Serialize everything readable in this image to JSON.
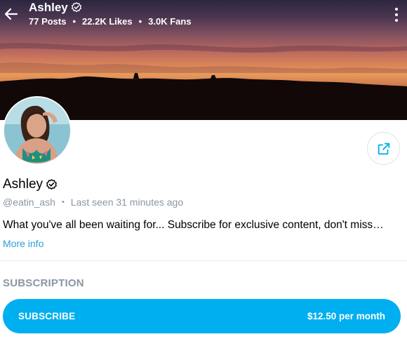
{
  "header": {
    "name": "Ashley",
    "posts": "77 Posts",
    "likes": "22.2K Likes",
    "fans": "3.0K Fans",
    "separator": "•"
  },
  "icons": {
    "back": "arrow-left-icon",
    "more": "more-vertical-icon",
    "verified": "verified-badge-icon",
    "share": "share-icon"
  },
  "profile": {
    "name": "Ashley",
    "username": "@eatin_ash",
    "separator": "•",
    "last_seen": "Last seen 31 minutes ago",
    "bio": "What you've all been waiting for... Subscribe for exclusive content, don't miss…",
    "more_info": "More info"
  },
  "subscription": {
    "title": "SUBSCRIPTION",
    "button_label": "SUBSCRIBE",
    "price": "$12.50 per month"
  },
  "colors": {
    "accent": "#00aff0",
    "link": "#2a9fd8",
    "muted": "#8a96a3"
  }
}
